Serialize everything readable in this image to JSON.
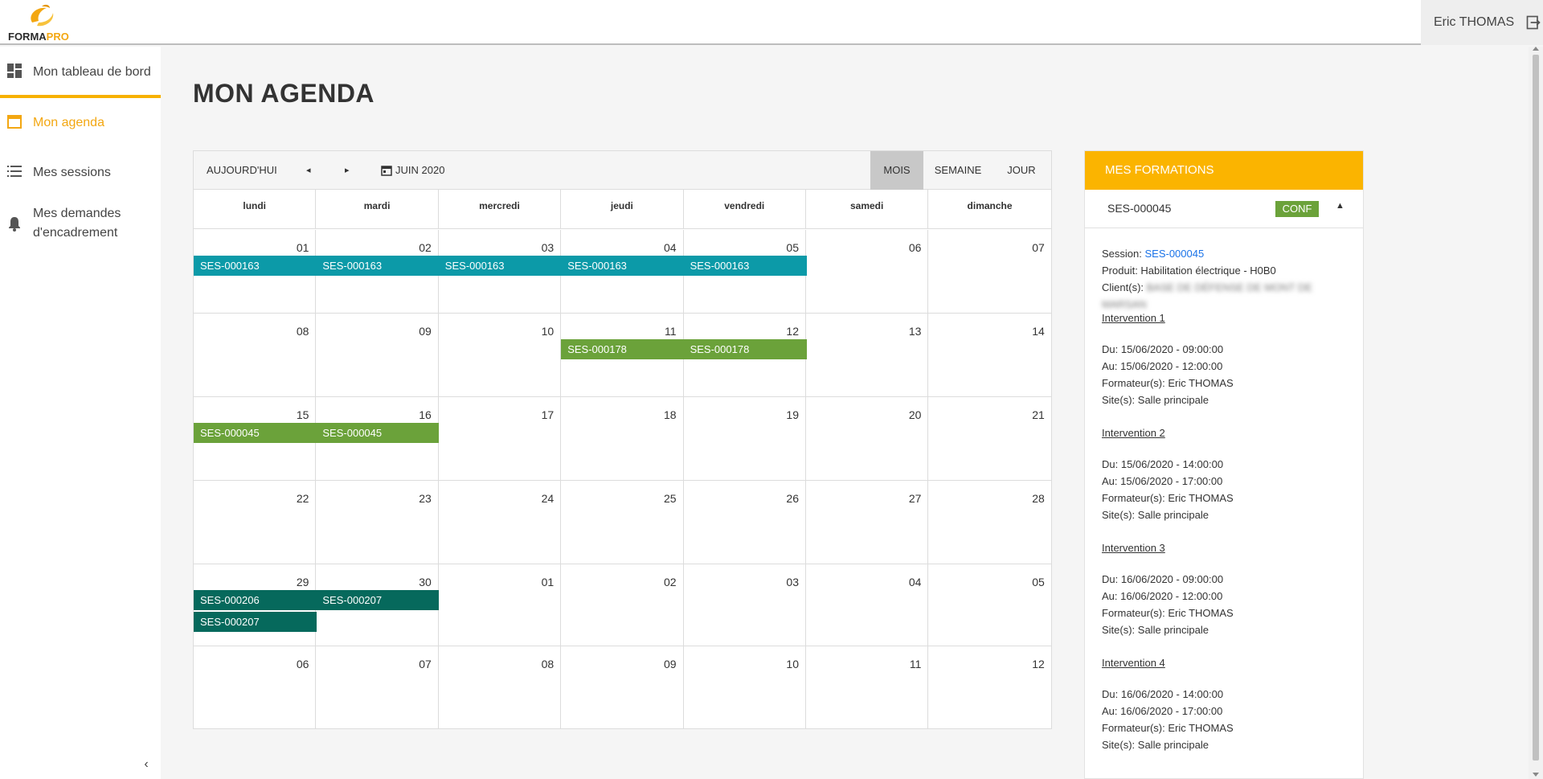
{
  "app": {
    "logo_part1": "FORMA",
    "logo_part2": "PRO",
    "brand_color": "#f7b100"
  },
  "user": {
    "name": "Eric THOMAS"
  },
  "sidebar": {
    "items": [
      {
        "label": "Mon tableau de bord",
        "icon": "dashboard-icon"
      },
      {
        "label": "Mon agenda",
        "icon": "calendar-icon",
        "active": true
      },
      {
        "label": "Mes sessions",
        "icon": "list-icon"
      },
      {
        "label": "Mes demandes",
        "label2": "d'encadrement",
        "icon": "bell-icon"
      }
    ],
    "collapse": "‹"
  },
  "page": {
    "title": "MON AGENDA"
  },
  "calendar": {
    "today": "AUJOURD'HUI",
    "prev": "◂",
    "next": "▸",
    "month_label": "JUIN 2020",
    "views": [
      "MOIS",
      "SEMAINE",
      "JOUR"
    ],
    "active_view": "MOIS",
    "days_of_week": [
      "lundi",
      "mardi",
      "mercredi",
      "jeudi",
      "vendredi",
      "samedi",
      "dimanche"
    ],
    "weeks": [
      [
        "01",
        "02",
        "03",
        "04",
        "05",
        "06",
        "07"
      ],
      [
        "08",
        "09",
        "10",
        "11",
        "12",
        "13",
        "14"
      ],
      [
        "15",
        "16",
        "17",
        "18",
        "19",
        "20",
        "21"
      ],
      [
        "22",
        "23",
        "24",
        "25",
        "26",
        "27",
        "28"
      ],
      [
        "29",
        "30",
        "01",
        "02",
        "03",
        "04",
        "05"
      ],
      [
        "06",
        "07",
        "08",
        "09",
        "10",
        "11",
        "12"
      ]
    ],
    "events": [
      {
        "label": "SES-000163",
        "week": 0,
        "day": 0,
        "lane": 0,
        "color": "#0c9aa8"
      },
      {
        "label": "SES-000163",
        "week": 0,
        "day": 1,
        "lane": 0,
        "color": "#0c9aa8"
      },
      {
        "label": "SES-000163",
        "week": 0,
        "day": 2,
        "lane": 0,
        "color": "#0c9aa8"
      },
      {
        "label": "SES-000163",
        "week": 0,
        "day": 3,
        "lane": 0,
        "color": "#0c9aa8"
      },
      {
        "label": "SES-000163",
        "week": 0,
        "day": 4,
        "lane": 0,
        "color": "#0c9aa8"
      },
      {
        "label": "SES-000178",
        "week": 1,
        "day": 3,
        "lane": 0,
        "color": "#6ba23a"
      },
      {
        "label": "SES-000178",
        "week": 1,
        "day": 4,
        "lane": 0,
        "color": "#6ba23a"
      },
      {
        "label": "SES-000045",
        "week": 2,
        "day": 0,
        "lane": 0,
        "color": "#6ba23a"
      },
      {
        "label": "SES-000045",
        "week": 2,
        "day": 1,
        "lane": 0,
        "color": "#6ba23a"
      },
      {
        "label": "SES-000206",
        "week": 4,
        "day": 0,
        "lane": 0,
        "color": "#06695c"
      },
      {
        "label": "SES-000207",
        "week": 4,
        "day": 1,
        "lane": 0,
        "color": "#06695c"
      },
      {
        "label": "SES-000207",
        "week": 4,
        "day": 0,
        "lane": 1,
        "color": "#06695c"
      }
    ]
  },
  "panel": {
    "title": "MES FORMATIONS",
    "session_code": "SES-000045",
    "status": "CONF",
    "caret": "▲",
    "session_label": "Session: ",
    "session_link": "SES-000045",
    "product": "Produit: Habilitation électrique - H0B0",
    "client_label": "Client(s): ",
    "client_blurred_1": "BASE DE DÉFENSE DE MONT DE",
    "client_blurred_2": "MARSAN",
    "interventions": [
      {
        "title": "Intervention 1",
        "du": "Du: 15/06/2020 - 09:00:00",
        "au": "Au: 15/06/2020 - 12:00:00",
        "formateur": "Formateur(s): Eric THOMAS",
        "site": "Site(s): Salle principale"
      },
      {
        "title": "Intervention 2",
        "du": "Du: 15/06/2020 - 14:00:00",
        "au": "Au: 15/06/2020 - 17:00:00",
        "formateur": "Formateur(s): Eric THOMAS",
        "site": "Site(s): Salle principale"
      },
      {
        "title": "Intervention 3",
        "du": "Du: 16/06/2020 - 09:00:00",
        "au": "Au: 16/06/2020 - 12:00:00",
        "formateur": "Formateur(s): Eric THOMAS",
        "site": "Site(s): Salle principale"
      },
      {
        "title": "Intervention 4",
        "du": "Du: 16/06/2020 - 14:00:00",
        "au": "Au: 16/06/2020 - 17:00:00",
        "formateur": "Formateur(s): Eric THOMAS",
        "site": "Site(s): Salle principale"
      }
    ]
  }
}
